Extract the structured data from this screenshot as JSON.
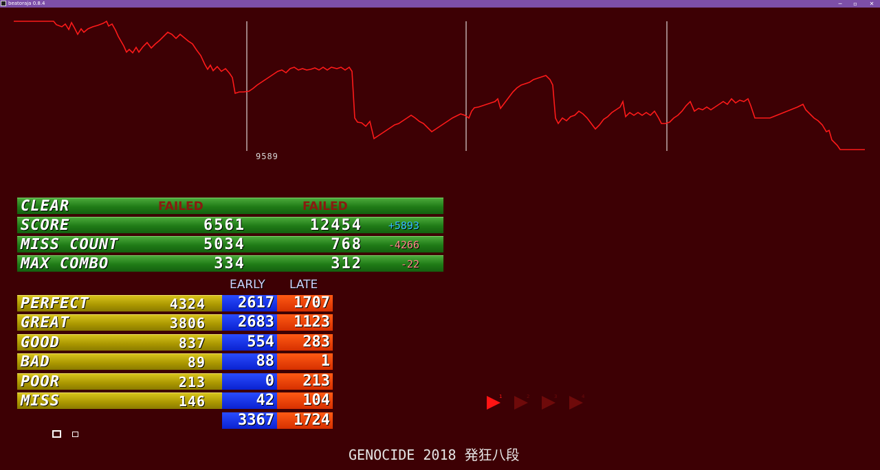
{
  "window": {
    "title": "beatoraja 0.8.4",
    "minimize": "─",
    "maximize": "▫",
    "close": "✕"
  },
  "graph": {
    "value_label": "9589",
    "colors": {
      "line": "#ff1a1a",
      "marker": "#ffffff"
    }
  },
  "results": [
    {
      "label": "CLEAR",
      "current": "FAILED",
      "best": "FAILED",
      "diff": ""
    },
    {
      "label": "SCORE",
      "current": "6561",
      "best": "12454",
      "diff": "+5893",
      "diff_sign": "pos"
    },
    {
      "label": "MISS COUNT",
      "current": "5034",
      "best": "768",
      "diff": "-4266",
      "diff_sign": "neg"
    },
    {
      "label": "MAX COMBO",
      "current": "334",
      "best": "312",
      "diff": "-22",
      "diff_sign": "neg"
    }
  ],
  "judge_headers": {
    "early": "EARLY",
    "late": "LATE"
  },
  "judges": [
    {
      "label": "PERFECT",
      "total": "4324",
      "early": "2617",
      "late": "1707"
    },
    {
      "label": "GREAT",
      "total": "3806",
      "early": "2683",
      "late": "1123"
    },
    {
      "label": "GOOD",
      "total": "837",
      "early": "554",
      "late": "283"
    },
    {
      "label": "BAD",
      "total": "89",
      "early": "88",
      "late": "1"
    },
    {
      "label": "POOR",
      "total": "213",
      "early": "0",
      "late": "213"
    },
    {
      "label": "MISS",
      "total": "146",
      "early": "42",
      "late": "104"
    }
  ],
  "judge_totals": {
    "early": "3367",
    "late": "1724"
  },
  "song_title": "GENOCIDE 2018 発狂八段",
  "player_buttons": [
    {
      "name": "play-1-icon",
      "label": "1",
      "active": true
    },
    {
      "name": "play-2-icon",
      "label": "2",
      "active": false
    },
    {
      "name": "play-3-icon",
      "label": "3",
      "active": false
    },
    {
      "name": "play-4-icon",
      "label": "4",
      "active": false
    }
  ]
}
